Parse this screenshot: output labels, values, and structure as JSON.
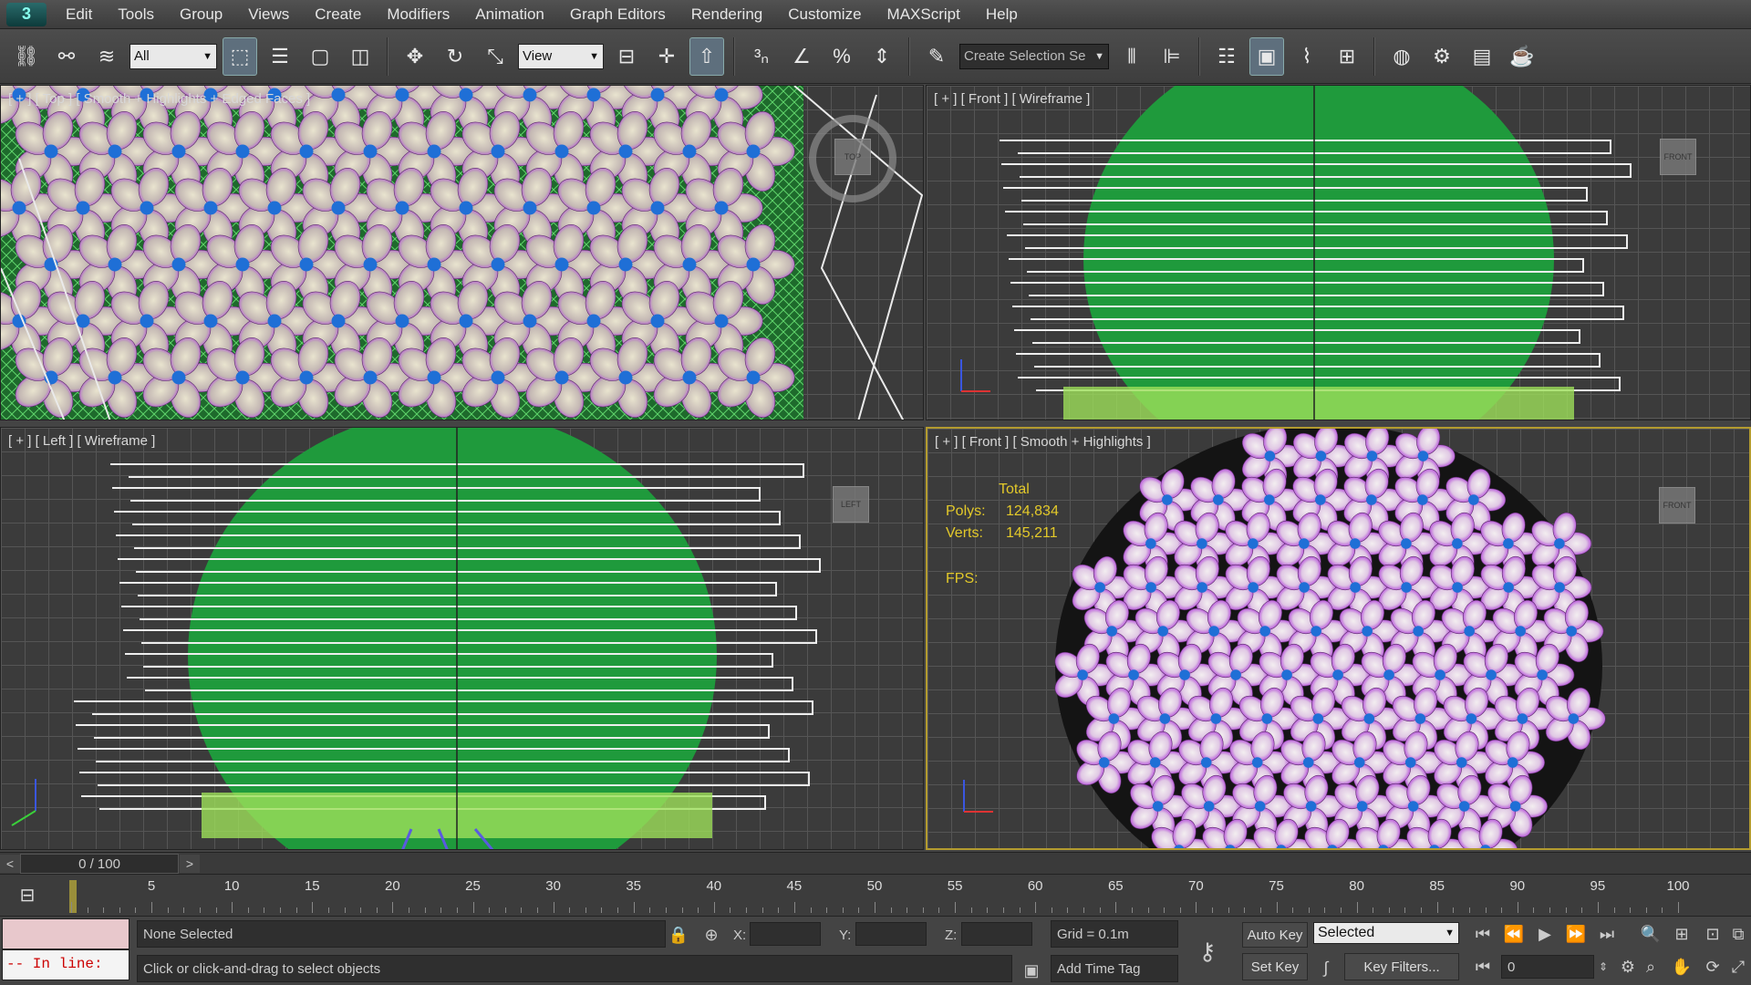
{
  "menu": {
    "logo": "3",
    "items": [
      "Edit",
      "Tools",
      "Group",
      "Views",
      "Create",
      "Modifiers",
      "Animation",
      "Graph Editors",
      "Rendering",
      "Customize",
      "MAXScript",
      "Help"
    ]
  },
  "toolbar": {
    "filter_value": "All",
    "ref_coord_value": "View",
    "named_selection_placeholder": "Create Selection Se",
    "icons": [
      "link-icon",
      "unlink-icon",
      "bind-spacewarp-icon",
      "select-object-icon",
      "select-by-name-icon",
      "rect-region-icon",
      "window-crossing-icon",
      "move-icon",
      "rotate-icon",
      "scale-icon",
      "pivot-icon",
      "select-manipulate-icon",
      "keyboard-shortcut-icon",
      "snap-3-icon",
      "angle-snap-icon",
      "percent-snap-icon",
      "spinner-snap-icon",
      "edit-named-sel-icon",
      "mirror-icon",
      "align-icon",
      "layer-manager-icon",
      "scene-explorer-icon",
      "curve-editor-icon",
      "schematic-icon",
      "material-editor-icon",
      "render-setup-icon",
      "rendered-frame-icon",
      "render-icon"
    ]
  },
  "viewports": {
    "top_left": {
      "label": "[ + ] [ Top ] [ Smooth + Highlights + Edged Faces ]",
      "cube": "TOP"
    },
    "top_right": {
      "label": "[ + ] [ Front ] [ Wireframe ]",
      "cube": "FRONT"
    },
    "bottom_left": {
      "label": "[ + ] [ Left ] [ Wireframe ]",
      "cube": "LEFT"
    },
    "bottom_right": {
      "label": "[ + ] [ Front ] [ Smooth + Highlights ]",
      "cube": "FRONT",
      "stats": {
        "header": "Total",
        "polys_label": "Polys:",
        "polys_value": "124,834",
        "verts_label": "Verts:",
        "verts_value": "145,211",
        "fps_label": "FPS:"
      }
    }
  },
  "timeslider": {
    "value": "0 / 100",
    "left_arrow": "<",
    "right_arrow": ">"
  },
  "trackbar": {
    "ticks": [
      "5",
      "10",
      "15",
      "20",
      "25",
      "30",
      "35",
      "40",
      "45",
      "50",
      "55",
      "60",
      "65",
      "70",
      "75",
      "80",
      "85",
      "90",
      "95",
      "100"
    ]
  },
  "status": {
    "maxscript_prompt": "-- In line:",
    "selection_text": "None Selected",
    "prompt_text": "Click or click-and-drag to select objects",
    "x_label": "X:",
    "y_label": "Y:",
    "z_label": "Z:",
    "grid_text": "Grid = 0.1m",
    "add_time_tag": "Add Time Tag",
    "auto_key": "Auto Key",
    "set_key": "Set Key",
    "key_mode_value": "Selected",
    "key_filters": "Key Filters...",
    "frame_value": "0"
  },
  "colors": {
    "stats_yellow": "#e3c92a",
    "active_border": "#b39b2f",
    "wire_green": "#1f9a3c",
    "flower_purple": "#b43be0"
  }
}
